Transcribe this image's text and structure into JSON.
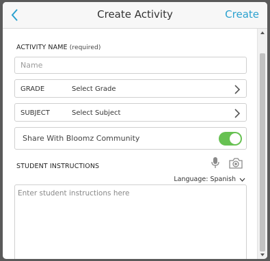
{
  "header": {
    "back_icon": "chevron-left-icon",
    "title": "Create Activity",
    "create_label": "Create"
  },
  "activity_name": {
    "label": "ACTIVITY NAME",
    "required": "(required)",
    "placeholder": "Name",
    "value": ""
  },
  "grade": {
    "label": "GRADE",
    "value": "Select Grade"
  },
  "subject": {
    "label": "SUBJECT",
    "value": "Select Subject"
  },
  "share": {
    "label": "Share With Bloomz Community",
    "enabled": true
  },
  "instructions": {
    "label": "STUDENT INSTRUCTIONS",
    "language": "Language: Spanish",
    "placeholder": "Enter student instructions here",
    "value": ""
  },
  "colors": {
    "accent": "#2aa1cf",
    "toggle_on": "#67c152"
  }
}
